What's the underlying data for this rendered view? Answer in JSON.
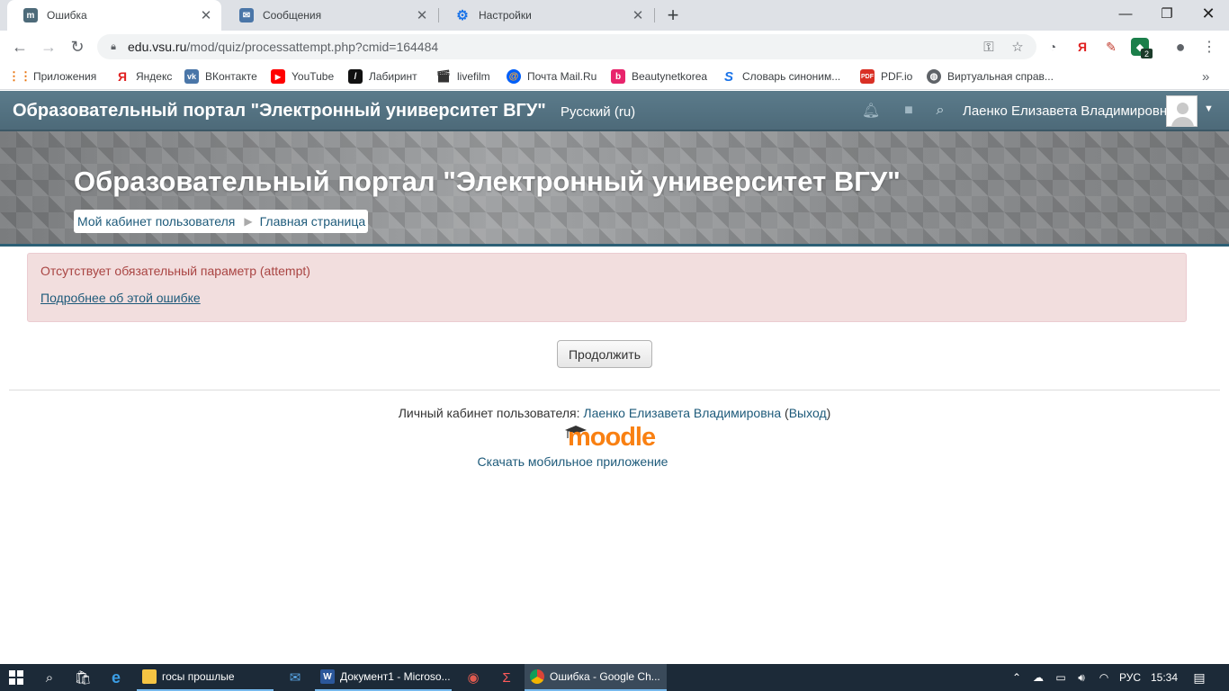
{
  "browser": {
    "tabs": [
      {
        "title": "Ошибка",
        "active": true
      },
      {
        "title": "Сообщения",
        "active": false
      },
      {
        "title": "Настройки",
        "active": false
      }
    ],
    "url_host": "edu.vsu.ru",
    "url_path": "/mod/quiz/processattempt.php?cmid=164484",
    "extension_badge": "2",
    "bookmarks": [
      {
        "label": "Приложения",
        "icon": "apps-grid-icon"
      },
      {
        "label": "Яндекс",
        "icon": "yandex-icon"
      },
      {
        "label": "ВКонтакте",
        "icon": "vk-icon"
      },
      {
        "label": "YouTube",
        "icon": "youtube-icon"
      },
      {
        "label": "Лабиринт",
        "icon": "labirint-icon"
      },
      {
        "label": "livefilm",
        "icon": "film-icon"
      },
      {
        "label": "Почта Mail.Ru",
        "icon": "mailru-icon"
      },
      {
        "label": "Beautynetkorea",
        "icon": "beautynet-icon"
      },
      {
        "label": "Словарь синоним...",
        "icon": "dictionary-icon"
      },
      {
        "label": "PDF.io",
        "icon": "pdf-icon"
      },
      {
        "label": "Виртуальная справ...",
        "icon": "globe-icon"
      }
    ]
  },
  "navbar": {
    "brand": "Образовательный портал \"Электронный университет ВГУ\"",
    "language": "Русский (ru)",
    "username": "Лаенко Елизавета Владимировна"
  },
  "header": {
    "title": "Образовательный портал \"Электронный университет ВГУ\"",
    "breadcrumbs": [
      "Мой кабинет пользователя",
      "Главная страница"
    ]
  },
  "error": {
    "message": "Отсутствует обязательный параметр (attempt)",
    "more_link": "Подробнее об этой ошибке"
  },
  "continue_label": "Продолжить",
  "footer": {
    "logged_in_prefix": "Личный кабинет пользователя: ",
    "user_link": "Лаенко Елизавета Владимировна",
    "open_paren": " (",
    "logout_link": "Выход",
    "close_paren": ")",
    "logo_text": "moodle",
    "mobile_app_link": "Скачать мобильное приложение"
  },
  "taskbar": {
    "tasks": [
      {
        "label": "госы прошлые",
        "icon": "folder-icon"
      },
      {
        "label": "Документ1 - Microso...",
        "icon": "word-icon"
      },
      {
        "label": "Ошибка - Google Ch...",
        "icon": "chrome-icon"
      }
    ],
    "language": "РУС",
    "time": "15:34"
  },
  "colors": {
    "navbar": "#4d6a79",
    "link": "#1d5a7a",
    "error_bg": "#f2dede",
    "error_text": "#a94442",
    "moodle_orange": "#f98012",
    "taskbar": "#1c2a38"
  }
}
